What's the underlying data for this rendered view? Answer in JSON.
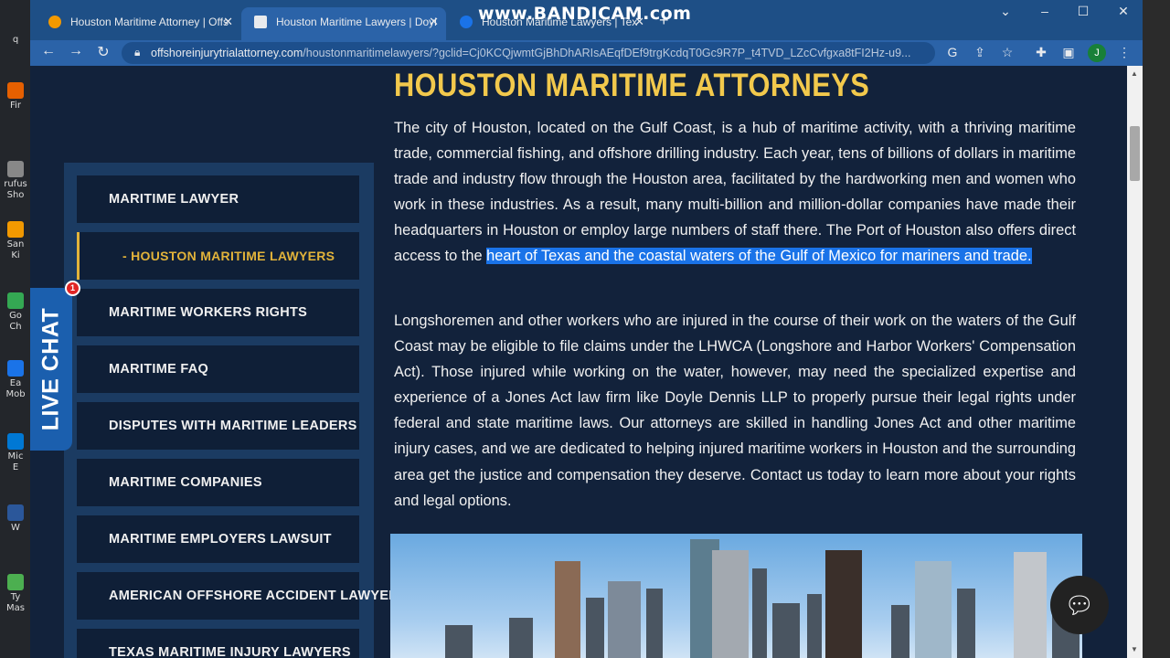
{
  "desktop": {
    "icons": [
      {
        "label": "q",
        "color": "#444"
      },
      {
        "label": "Fir",
        "color": "#e66000"
      },
      {
        "label": "rufus Sho",
        "color": "#888"
      },
      {
        "label": "San Ki",
        "color": "#f29900"
      },
      {
        "label": "Go Ch",
        "color": "#34a853"
      },
      {
        "label": "Ea Mob",
        "color": "#1a73e8"
      },
      {
        "label": "Mic E",
        "color": "#0078d4"
      },
      {
        "label": "W",
        "color": "#2b579a"
      },
      {
        "label": "Ty Mas",
        "color": "#4caf50"
      }
    ]
  },
  "watermark": "www.BANDICAM.com",
  "browser": {
    "tabs": [
      {
        "title": "Houston Maritime Attorney | Offs",
        "active": false,
        "fav_color": "#f29900"
      },
      {
        "title": "Houston Maritime Lawyers | Doyl",
        "active": true,
        "fav_color": "#e8eaed"
      },
      {
        "title": "Houston Maritime Lawyers | Tex",
        "active": false,
        "fav_color": "#1a73e8"
      }
    ],
    "new_tab": "+",
    "url_host": "offshoreinjurytrialattorney.com",
    "url_path": "/houstonmaritimelawyers/?gclid=Cj0KCQjwmtGjBhDhARIsAEqfDEf9trgKcdqT0Gc9R7P_t4TVD_LZcCvfgxa8tFI2Hz-u9...",
    "avatar_letter": "J"
  },
  "page": {
    "heading": "HOUSTON MARITIME ATTORNEYS",
    "para1_a": "The city of Houston, located on the Gulf Coast, is a hub of maritime activity, with a thriving maritime trade, commercial fishing, and offshore drilling industry. Each year, tens of billions of dollars in maritime trade and industry flow through the Houston area, facilitated by the hardworking men and women who work in these industries. As a result, many multi-billion and million-dollar companies have made their headquarters in Houston or employ large numbers of staff there. The Port of Houston also offers direct access to the ",
    "para1_highlight": "heart of Texas and the coastal waters of the Gulf of Mexico for mariners and trade.",
    "para2": "Longshoremen and other workers who are injured in the course of their work on the waters of the Gulf Coast may be eligible to file claims under the LHWCA (Longshore and Harbor Workers' Compensation Act). Those injured while working on the water, however, may need the specialized expertise and experience of a Jones Act law firm like Doyle Dennis LLP to properly pursue their legal rights under federal and state maritime laws. Our attorneys are skilled in handling Jones Act and other maritime injury cases, and we are dedicated to helping injured maritime workers in Houston and the surrounding area get the justice and compensation they deserve. Contact us today to learn more about your rights and legal options.",
    "sidebar": [
      "MARITIME LAWYER",
      "- HOUSTON MARITIME LAWYERS",
      "MARITIME WORKERS RIGHTS",
      "MARITIME FAQ",
      "DISPUTES WITH MARITIME LEADERS",
      "MARITIME COMPANIES",
      "MARITIME EMPLOYERS LAWSUIT",
      "AMERICAN OFFSHORE ACCIDENT LAWYERS",
      "TEXAS MARITIME INJURY LAWYERS"
    ],
    "live_chat": "LIVE CHAT",
    "chat_badge": "1"
  }
}
